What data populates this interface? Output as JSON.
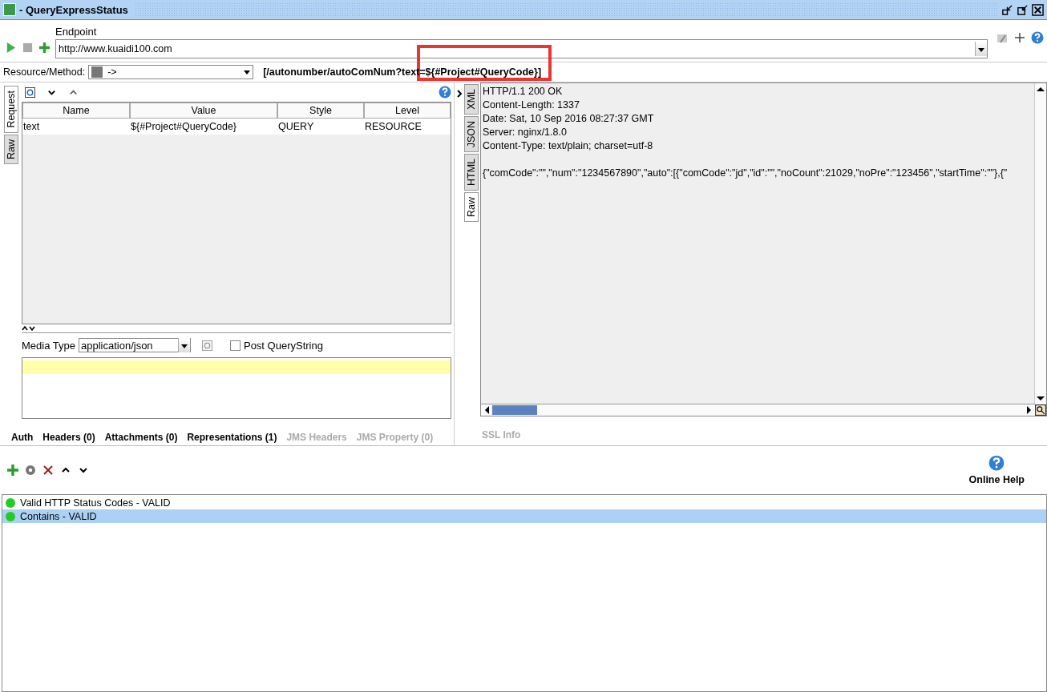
{
  "window": {
    "title": "- QueryExpressStatus"
  },
  "endpoint": {
    "label": "Endpoint",
    "value": "http://www.kuaidi100.com"
  },
  "resource": {
    "label": "Resource/Method:",
    "method": "->",
    "path": "[/autonumber/autoComNum?text=${#Project#QueryCode}]"
  },
  "request_tabs": [
    {
      "label": "Request",
      "selected": true
    },
    {
      "label": "Raw",
      "selected": false
    }
  ],
  "params": {
    "columns": [
      "Name",
      "Value",
      "Style",
      "Level"
    ],
    "rows": [
      [
        "text",
        "${#Project#QueryCode}",
        "QUERY",
        "RESOURCE"
      ]
    ]
  },
  "media_type": {
    "label": "Media Type",
    "value": "application/json",
    "post_querystring": {
      "label": "Post QueryString",
      "checked": false
    }
  },
  "bottom_tabs": [
    {
      "label": "Auth",
      "disabled": false
    },
    {
      "label": "Headers (0)",
      "disabled": false
    },
    {
      "label": "Attachments (0)",
      "disabled": false
    },
    {
      "label": "Representations (1)",
      "disabled": false
    },
    {
      "label": "JMS Headers",
      "disabled": true
    },
    {
      "label": "JMS Property (0)",
      "disabled": true
    }
  ],
  "response_tabs": [
    {
      "label": "XML",
      "selected": false
    },
    {
      "label": "JSON",
      "selected": false
    },
    {
      "label": "HTML",
      "selected": false
    },
    {
      "label": "Raw",
      "selected": true
    }
  ],
  "response_lines": [
    "HTTP/1.1 200 OK",
    "Content-Length: 1337",
    "Date: Sat, 10 Sep 2016 08:27:37 GMT",
    "Server: nginx/1.8.0",
    "Content-Type: text/plain; charset=utf-8"
  ],
  "response_body": "{\"comCode\":\"\",\"num\":\"1234567890\",\"auto\":[{\"comCode\":\"jd\",\"id\":\"\",\"noCount\":21029,\"noPre\":\"123456\",\"startTime\":\"\"},{\"",
  "response_bottom_tabs": [
    {
      "label": "SSL Info",
      "disabled": true
    }
  ],
  "online_help": "Online Help",
  "assertions": [
    {
      "label": "Valid HTTP Status Codes - VALID",
      "color": "#22cc22",
      "selected": false
    },
    {
      "label": "Contains - VALID",
      "color": "#22cc22",
      "selected": true
    }
  ]
}
